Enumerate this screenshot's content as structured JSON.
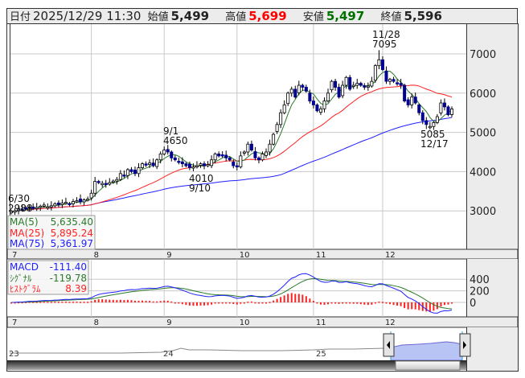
{
  "header": {
    "date_label": "日付",
    "date": "2025/12/29 11:30",
    "open_label": "始値",
    "open": "5,499",
    "high_label": "高値",
    "high": "5,699",
    "low_label": "安値",
    "low": "5,497",
    "close_label": "終値",
    "close": "5,596"
  },
  "legend_ma": [
    {
      "label": "MA(5)",
      "value": "5,635.40",
      "color": "#2a7a2a"
    },
    {
      "label": "MA(25)",
      "value": "5,895.24",
      "color": "#ff2020"
    },
    {
      "label": "MA(75)",
      "value": "5,361.97",
      "color": "#2020ff"
    }
  ],
  "legend_macd": [
    {
      "label": "MACD",
      "value": "-111.40",
      "color": "#2020ff"
    },
    {
      "label": "ｼｸﾞﾅﾙ",
      "value": "-119.78",
      "color": "#2a7a2a"
    },
    {
      "label": "ﾋｽﾄｸﾞﾗﾑ",
      "value": "8.39",
      "color": "#ff2020"
    }
  ],
  "annotations": [
    {
      "line1": "6/30",
      "line2": "2988"
    },
    {
      "line1": "9/1",
      "line2": "4650"
    },
    {
      "line1": "4010",
      "line2": "9/10"
    },
    {
      "line1": "11/28",
      "line2": "7095"
    },
    {
      "line1": "5085",
      "line2": "12/17"
    }
  ],
  "navigator": {
    "year_labels": [
      "23",
      "24",
      "25"
    ]
  },
  "chart_data": {
    "type": "candlestick",
    "month_labels": [
      "7",
      "8",
      "9",
      "10",
      "11",
      "12"
    ],
    "price_ticks": [
      3000,
      4000,
      5000,
      6000,
      7000
    ],
    "macd_ticks": [
      0,
      200,
      400
    ],
    "ylim": [
      2000,
      7700
    ],
    "up_color": "#ffffff",
    "down_color": "#000090",
    "month_start_index": [
      0,
      22,
      42,
      62,
      83,
      102
    ],
    "closes": [
      2988,
      3000,
      3050,
      3020,
      3080,
      3100,
      3060,
      3090,
      3120,
      3150,
      3100,
      3130,
      3180,
      3160,
      3200,
      3220,
      3180,
      3240,
      3260,
      3230,
      3280,
      3300,
      3450,
      3750,
      3720,
      3700,
      3680,
      3720,
      3760,
      3800,
      3950,
      3900,
      4050,
      4000,
      3950,
      4100,
      4200,
      4180,
      4220,
      4150,
      4300,
      4450,
      4550,
      4500,
      4350,
      4300,
      4250,
      4200,
      4150,
      4100,
      4120,
      4150,
      4200,
      4150,
      4180,
      4300,
      4450,
      4400,
      4420,
      4350,
      4300,
      4150,
      4120,
      4400,
      4500,
      4700,
      4550,
      4350,
      4300,
      4450,
      4500,
      4700,
      4950,
      5200,
      5500,
      5700,
      6000,
      6100,
      5900,
      6200,
      6150,
      6050,
      5800,
      5700,
      5550,
      5600,
      5800,
      6000,
      6300,
      6150,
      5900,
      6200,
      6400,
      6100,
      6200,
      6250,
      6200,
      6150,
      6180,
      6300,
      6700,
      6850,
      6600,
      6300,
      6350,
      6300,
      6250,
      6200,
      5800,
      5700,
      5900,
      5750,
      5500,
      5300,
      5200,
      5150,
      5250,
      5400,
      5750,
      5650,
      5450,
      5596
    ],
    "marked_high": {
      "date": "11/28",
      "value": 7095
    },
    "marked_low": {
      "date": "12/17",
      "value": 5085
    }
  }
}
